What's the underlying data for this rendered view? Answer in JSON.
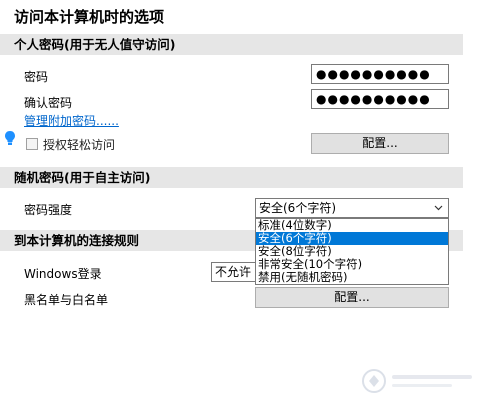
{
  "dialog": {
    "title": "访问本计算机时的选项"
  },
  "personal_password": {
    "header": "个人密码(用于无人值守访问)",
    "password_label": "密码",
    "password_value": "●●●●●●●●●●",
    "confirm_label": "确认密码",
    "confirm_value": "●●●●●●●●●●",
    "manage_link": "管理附加密码......",
    "easy_access_label": "授权轻松访问",
    "configure_label": "配置..."
  },
  "random_password": {
    "header": "随机密码(用于自主访问)",
    "strength_label": "密码强度",
    "strength_value": "安全(6个字符)",
    "options": [
      "标准(4位数字)",
      "安全(6个字符)",
      "安全(8位字符)",
      "非常安全(10个字符)",
      "禁用(无随机密码)"
    ],
    "selected_index": 1
  },
  "connection_rules": {
    "header": "到本计算机的连接规则",
    "windows_login_label": "Windows登录",
    "windows_login_value": "不允许",
    "blacklist_label": "黑名单与白名单",
    "configure_label": "配置..."
  },
  "colors": {
    "selection": "#0078d7",
    "link": "#0066cc",
    "section_bg": "#e6e6e6"
  }
}
